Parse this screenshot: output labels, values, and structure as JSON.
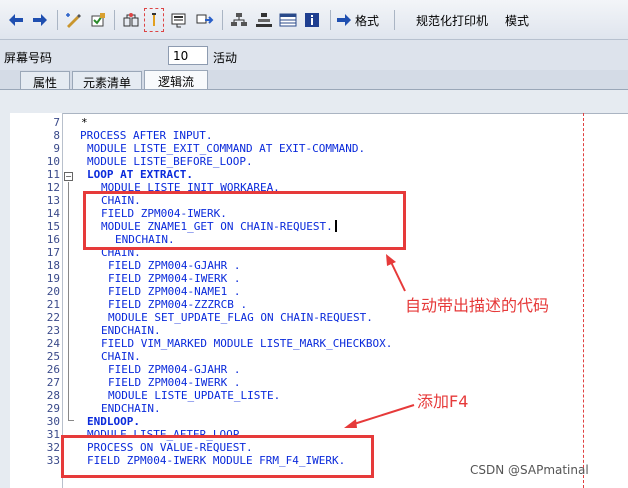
{
  "toolbar": {
    "format_label": "格式",
    "pretty_printer_label": "规范化打印机",
    "mode_label": "模式"
  },
  "screen": {
    "screen_number_label": "屏幕号码",
    "screen_number_value": "10",
    "status_label": "活动"
  },
  "tabs": [
    {
      "label": "属性"
    },
    {
      "label": "元素清单"
    },
    {
      "label": "逻辑流"
    }
  ],
  "editor": {
    "lines": [
      {
        "num": "7",
        "text": "*"
      },
      {
        "num": "8",
        "text": "PROCESS AFTER INPUT."
      },
      {
        "num": "9",
        "text": "MODULE LISTE_EXIT_COMMAND AT EXIT-COMMAND."
      },
      {
        "num": "10",
        "text": "MODULE LISTE_BEFORE_LOOP."
      },
      {
        "num": "11",
        "text": "LOOP AT EXTRACT."
      },
      {
        "num": "12",
        "text": "MODULE LISTE_INIT_WORKAREA."
      },
      {
        "num": "13",
        "text": "CHAIN."
      },
      {
        "num": "14",
        "text": "FIELD ZPM004-IWERK."
      },
      {
        "num": "15",
        "text": "MODULE ZNAME1_GET ON CHAIN-REQUEST."
      },
      {
        "num": "16",
        "text": "ENDCHAIN."
      },
      {
        "num": "17",
        "text": "CHAIN."
      },
      {
        "num": "18",
        "text": "FIELD ZPM004-GJAHR ."
      },
      {
        "num": "19",
        "text": "FIELD ZPM004-IWERK ."
      },
      {
        "num": "20",
        "text": "FIELD ZPM004-NAME1 ."
      },
      {
        "num": "21",
        "text": "FIELD ZPM004-ZZZRCB ."
      },
      {
        "num": "22",
        "text": "MODULE SET_UPDATE_FLAG ON CHAIN-REQUEST."
      },
      {
        "num": "23",
        "text": "ENDCHAIN."
      },
      {
        "num": "24",
        "text": "FIELD VIM_MARKED MODULE LISTE_MARK_CHECKBOX."
      },
      {
        "num": "25",
        "text": "CHAIN."
      },
      {
        "num": "26",
        "text": "FIELD ZPM004-GJAHR ."
      },
      {
        "num": "27",
        "text": "FIELD ZPM004-IWERK ."
      },
      {
        "num": "28",
        "text": "MODULE LISTE_UPDATE_LISTE."
      },
      {
        "num": "29",
        "text": "ENDCHAIN."
      },
      {
        "num": "30",
        "text": "ENDLOOP."
      },
      {
        "num": "31",
        "text": "MODULE LISTE_AFTER_LOOP."
      },
      {
        "num": "32",
        "text": "PROCESS ON VALUE-REQUEST."
      },
      {
        "num": "33",
        "text": "FIELD ZPM004-IWERK MODULE FRM_F4_IWERK."
      }
    ]
  },
  "annotations": {
    "auto_code_note": "自动带出描述的代码",
    "add_f4_note": "添加F4"
  },
  "watermark": "CSDN @SAPmatinal",
  "colors": {
    "keyword": "#0a2adb",
    "annotation": "#e63a3a",
    "line_number": "#3a4a8a"
  }
}
